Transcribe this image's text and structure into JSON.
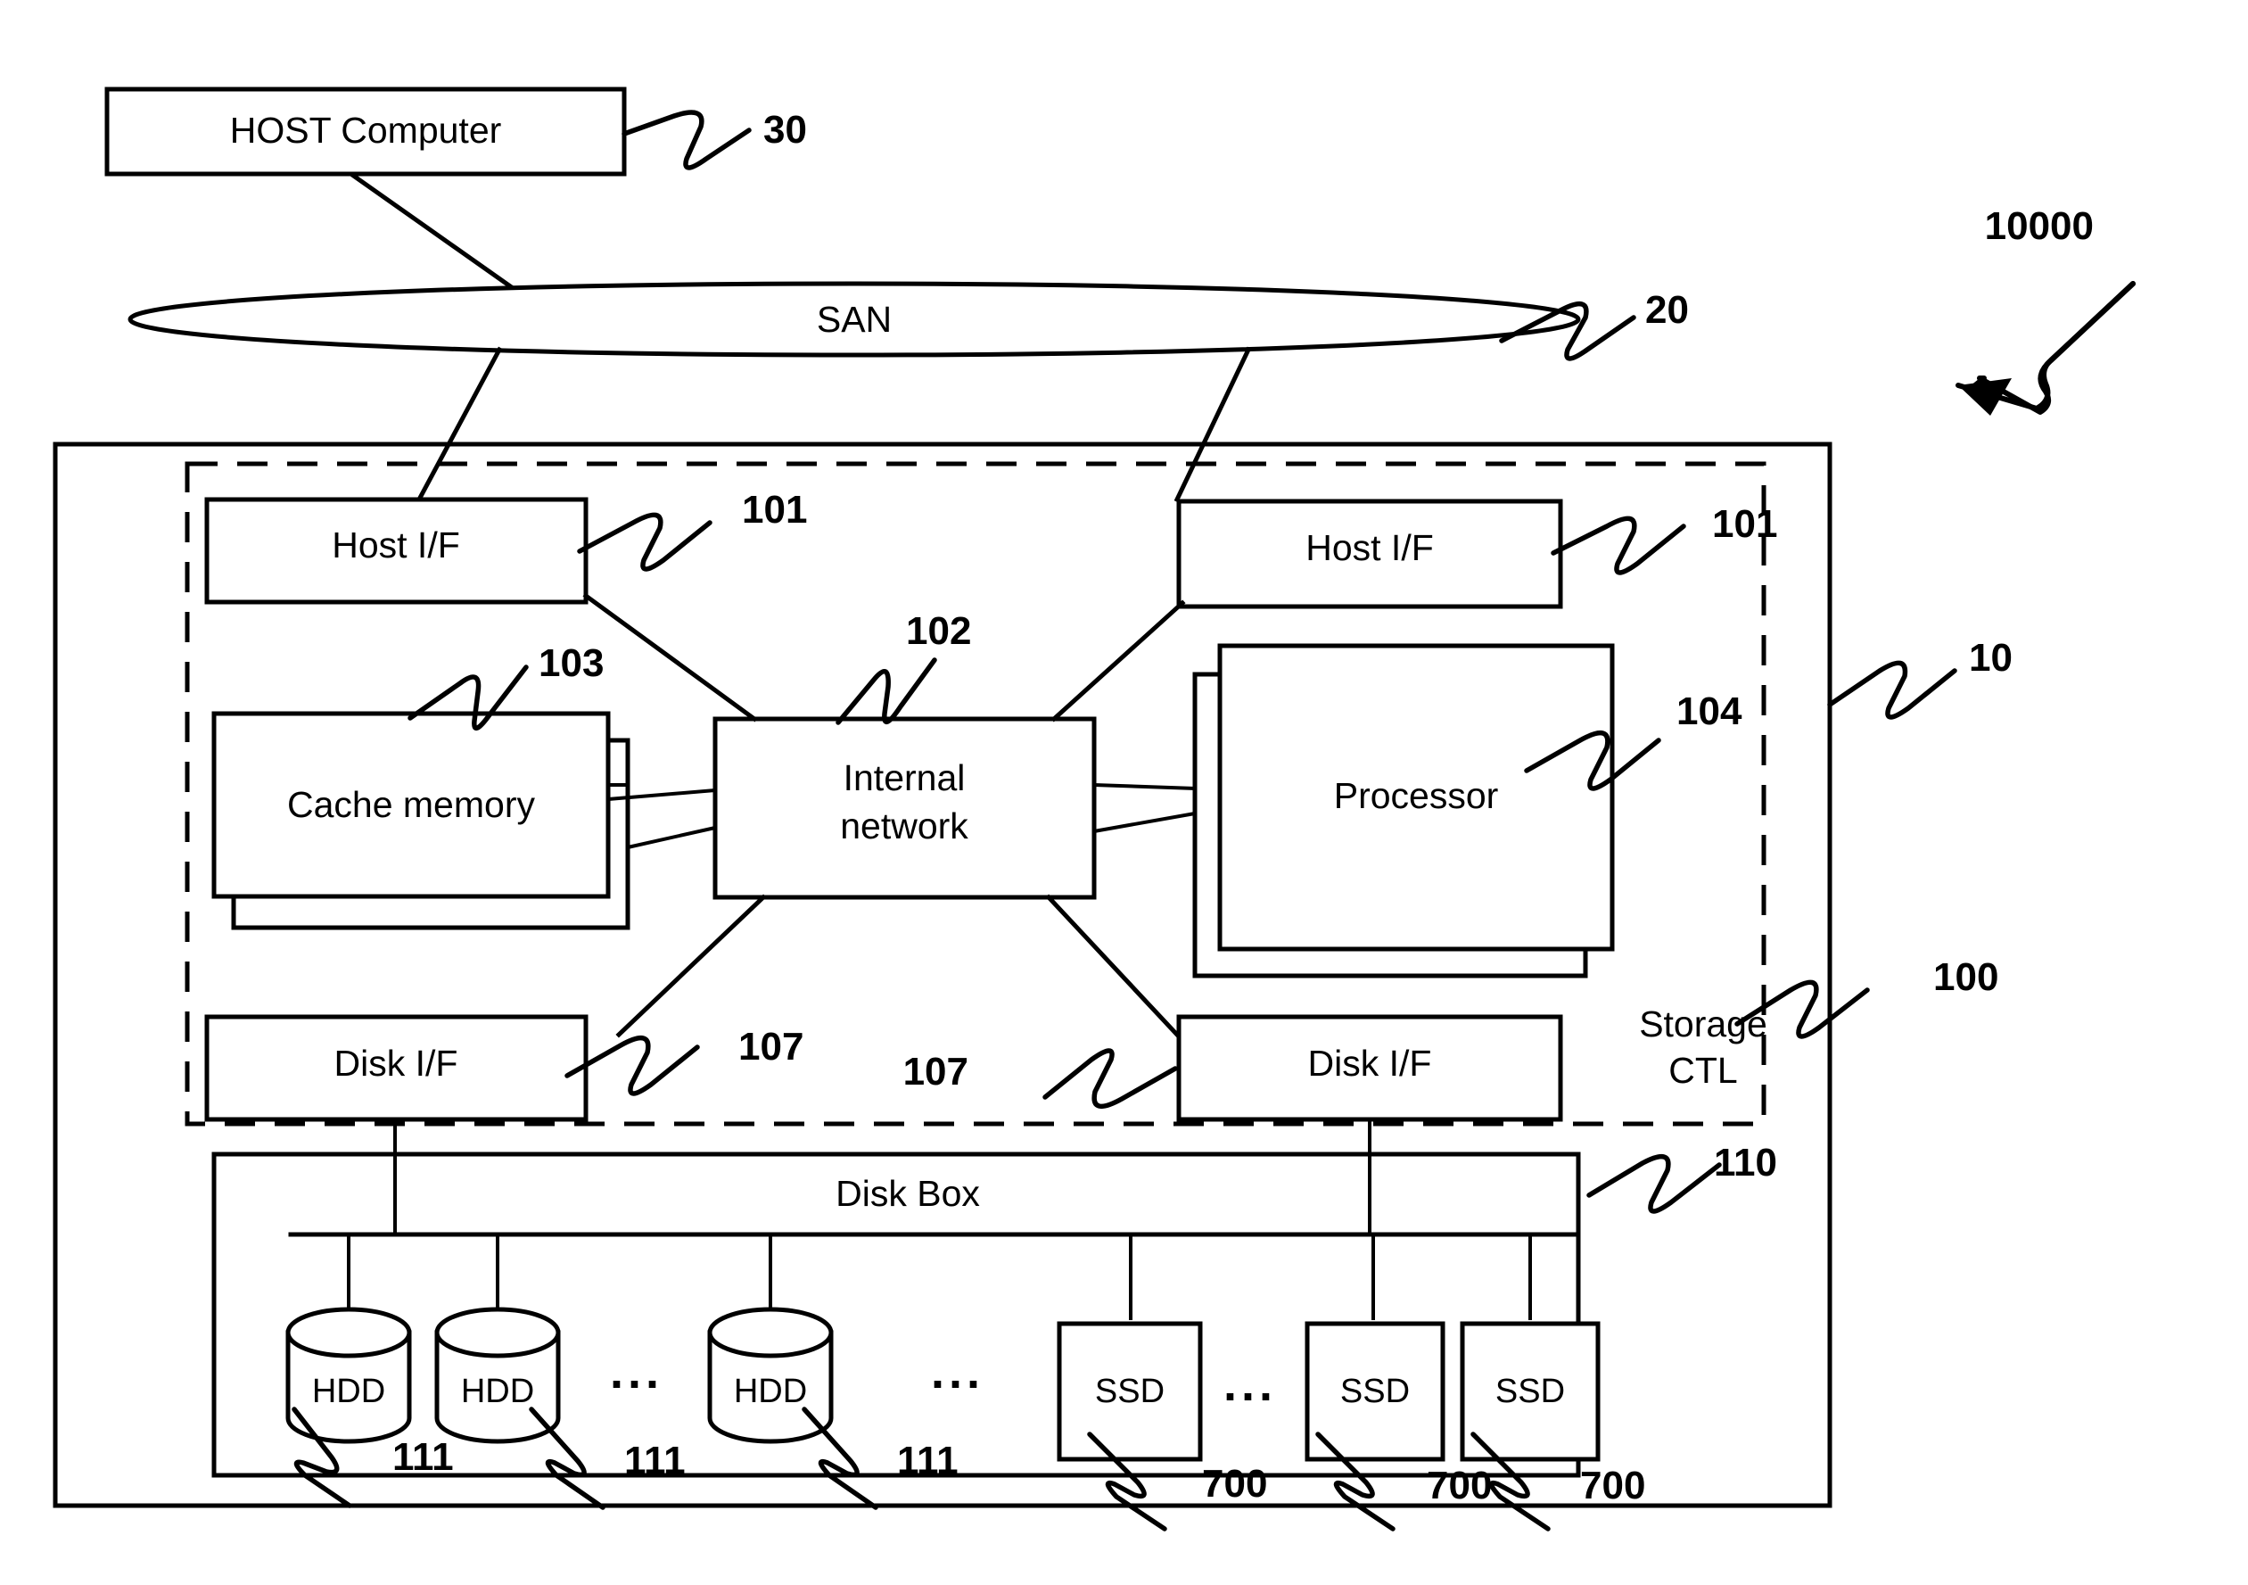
{
  "figure": {
    "system_ref": "10000",
    "blocks": {
      "host_computer": "HOST Computer",
      "san": "SAN",
      "host_if_left": "Host I/F",
      "host_if_right": "Host I/F",
      "cache_memory": "Cache memory",
      "internal_network_line1": "Internal",
      "internal_network_line2": "network",
      "processor": "Processor",
      "disk_if_left": "Disk I/F",
      "disk_if_right": "Disk I/F",
      "disk_box": "Disk Box",
      "storage_ctl_line1": "Storage",
      "storage_ctl_line2": "CTL",
      "hdd_1": "HDD",
      "hdd_2": "HDD",
      "hdd_3": "HDD",
      "ssd_1": "SSD",
      "ssd_2": "SSD",
      "ssd_3": "SSD",
      "ellipsis_1": "...",
      "ellipsis_2": "...",
      "ellipsis_3": "..."
    },
    "reference_numerals": {
      "host_computer": "30",
      "san": "20",
      "storage_system": "10",
      "storage_ctl": "100",
      "host_if_left": "101",
      "host_if_right": "101",
      "internal_network": "102",
      "cache_memory": "103",
      "processor": "104",
      "disk_if_left": "107",
      "disk_if_right": "107",
      "disk_box": "110",
      "hdd_1": "111",
      "hdd_2": "111",
      "hdd_3": "111",
      "ssd_1": "700",
      "ssd_2": "700",
      "ssd_3": "700"
    },
    "colors": {
      "ink": "#000000",
      "paper": "#ffffff"
    }
  }
}
